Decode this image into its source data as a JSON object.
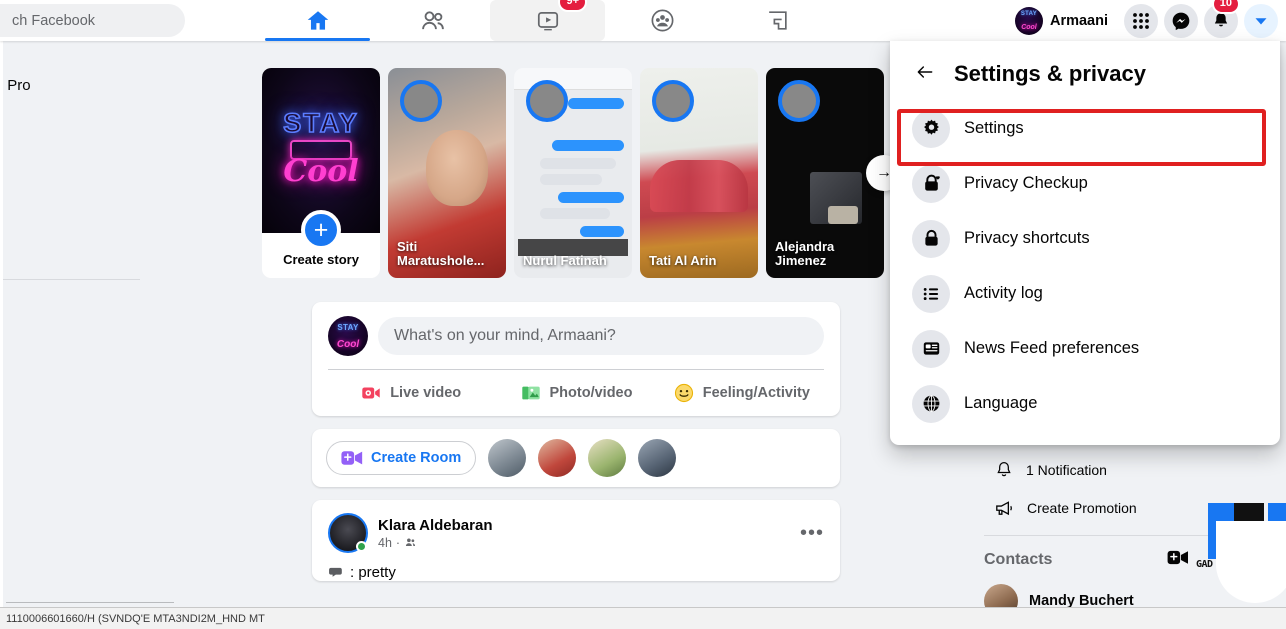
{
  "topnav": {
    "search_placeholder": "ch Facebook",
    "tabs": [
      {
        "name": "home",
        "icon": "home-icon",
        "active": true
      },
      {
        "name": "friends",
        "icon": "friends-icon",
        "active": false
      },
      {
        "name": "watch",
        "icon": "watch-icon",
        "active": false,
        "badge": "9+"
      },
      {
        "name": "groups",
        "icon": "groups-icon",
        "active": false
      },
      {
        "name": "gaming",
        "icon": "gaming-icon",
        "active": false
      }
    ],
    "profile_name": "Armaani",
    "menu_badge": "10",
    "right_icons": [
      "grid-menu-icon",
      "messenger-icon",
      "bell-icon",
      "chevron-down-icon"
    ]
  },
  "left_sidebar": {
    "item_label": "olourfit Pro"
  },
  "stories": {
    "create": {
      "label": "Create story",
      "neon_top": "STAY",
      "neon_bottom": "Cool"
    },
    "items": [
      {
        "name": "Siti Maratushole..."
      },
      {
        "name": "Nurul Fatinah"
      },
      {
        "name": "Tati Al Arin"
      },
      {
        "name": "Alejandra Jimenez"
      }
    ],
    "next_arrow": "→"
  },
  "composer": {
    "placeholder": "What's on your mind, Armaani?",
    "actions": [
      {
        "label": "Live video",
        "icon": "live-video-icon",
        "color": "#f3425f"
      },
      {
        "label": "Photo/video",
        "icon": "photo-video-icon",
        "color": "#45bd62"
      },
      {
        "label": "Feeling/Activity",
        "icon": "feeling-activity-icon",
        "color": "#f7b928"
      }
    ]
  },
  "rooms": {
    "create_room_label": "Create Room",
    "contact_count": 4
  },
  "post": {
    "author": "Klara Aldebaran",
    "time": "4h",
    "audience_icon": "friends-audience-icon",
    "menu_icon": "more-options-icon",
    "body_text": ": pretty"
  },
  "right_sidebar": {
    "rows": [
      {
        "label": "1 Notification",
        "icon": "bell-outline-icon"
      },
      {
        "label": "Create Promotion",
        "icon": "megaphone-icon"
      }
    ],
    "contacts_title": "Contacts",
    "contacts": [
      {
        "name": "Mandy Buchert"
      }
    ],
    "new_room_icon": "video-plus-icon"
  },
  "menu_popup": {
    "back_icon": "back-arrow-icon",
    "title": "Settings & privacy",
    "items": [
      {
        "label": "Settings",
        "icon": "gear-icon",
        "highlighted": true
      },
      {
        "label": "Privacy Checkup",
        "icon": "lock-heart-icon",
        "highlighted": false
      },
      {
        "label": "Privacy shortcuts",
        "icon": "lock-icon",
        "highlighted": false
      },
      {
        "label": "Activity log",
        "icon": "list-icon",
        "highlighted": false
      },
      {
        "label": "News Feed preferences",
        "icon": "news-feed-icon",
        "highlighted": false
      },
      {
        "label": "Language",
        "icon": "globe-icon",
        "highlighted": false
      }
    ],
    "highlight_color": "#e02020"
  },
  "watermark": {
    "text": "GAD"
  },
  "status_bar": {
    "text": "1110006601660/H  (SVNDQ'E  MTA3NDI2M_HND  MT"
  },
  "colors": {
    "brand_blue": "#1877f2",
    "page_bg": "#f0f2f5",
    "card_white": "#ffffff",
    "text_primary": "#050505",
    "text_secondary": "#65676b",
    "highlight_red": "#e02020",
    "badge_red": "#e41e3f",
    "online_green": "#31a24c"
  }
}
